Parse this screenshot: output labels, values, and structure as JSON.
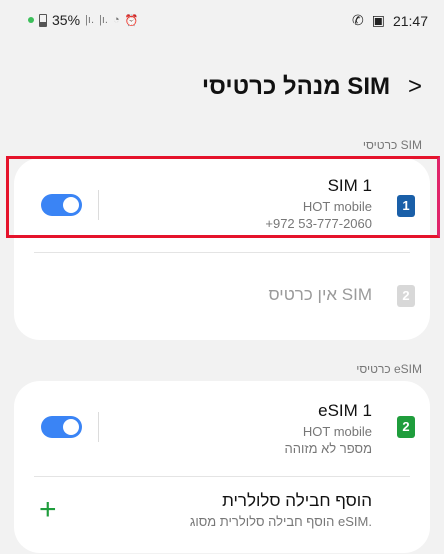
{
  "status_bar": {
    "battery": "35%",
    "time": "21:47"
  },
  "header": {
    "title": "מנהל כרטיסי SIM",
    "back_icon": "chevron-right-icon"
  },
  "sections": {
    "sim_cards": "כרטיסי SIM",
    "esim_cards": "כרטיסי eSIM"
  },
  "sim_card": {
    "name": "SIM 1",
    "carrier": "HOT mobile",
    "number": "+972 53-777-2060",
    "slot": "1",
    "enabled": true
  },
  "empty_slot": {
    "label": "אין כרטיס SIM",
    "slot": "2"
  },
  "esim_card": {
    "name": "eSIM 1",
    "carrier": "HOT mobile",
    "number": "מספר לא מזוהה",
    "slot": "2",
    "enabled": true
  },
  "add_plan": {
    "title": "הוסף חבילה סלולרית",
    "subtitle": "הוסף חבילה סלולרית מסוג eSIM."
  },
  "colors": {
    "toggle_on": "#3a84f5",
    "sim_blue": "#1a5fa8",
    "esim_green": "#1f9d3c",
    "highlight": "#e5132b"
  }
}
